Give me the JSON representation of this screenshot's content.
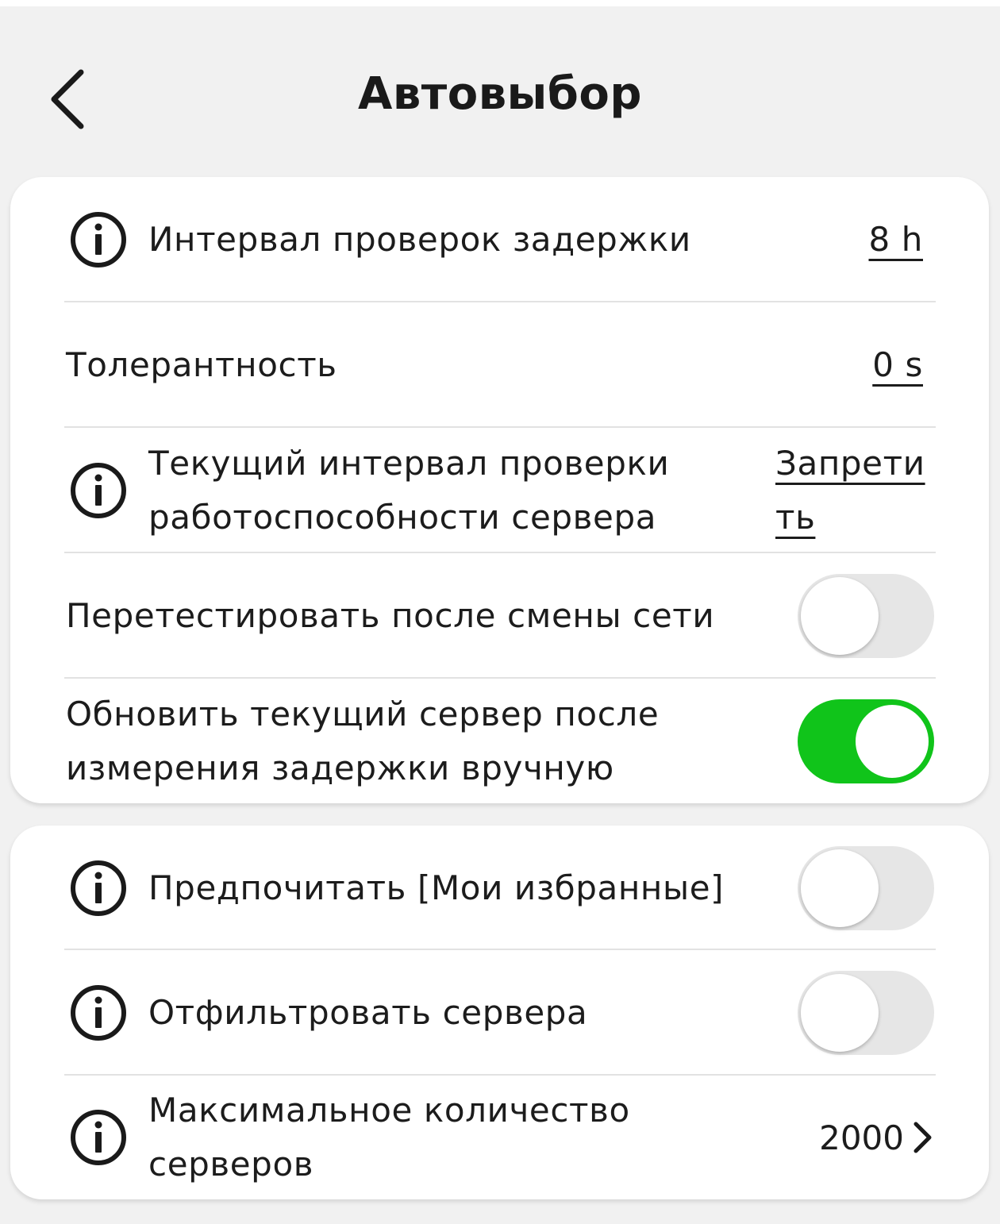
{
  "header": {
    "title": "Автовыбор",
    "back_icon": "chevron-left-icon"
  },
  "group1": {
    "latency_interval": {
      "label": "Интервал проверок задержки",
      "value": "8 h",
      "icon": "info-icon"
    },
    "tolerance": {
      "label": "Толерантность",
      "value": "0 s"
    },
    "health_check": {
      "label_line1": "Текущий интервал проверки",
      "label_line2": "работоспособности сервера",
      "value_line1": "Запрети",
      "value_line2": "ть",
      "icon": "info-icon"
    },
    "retest_network": {
      "label": "Перетестировать после смены сети",
      "enabled": false
    },
    "update_after_manual": {
      "label_line1": "Обновить текущий сервер после",
      "label_line2": "измерения задержки вручную",
      "enabled": true
    }
  },
  "group2": {
    "prefer_favorites": {
      "label": "Предпочитать [Мои избранные]",
      "enabled": false,
      "icon": "info-icon"
    },
    "filter_servers": {
      "label": "Отфильтровать сервера",
      "enabled": false,
      "icon": "info-icon"
    },
    "max_servers": {
      "label_line1": "Максимальное количество",
      "label_line2": "серверов",
      "value": "2000",
      "icon": "info-icon"
    }
  },
  "colors": {
    "toggle_on": "#10c41a",
    "toggle_off": "#e6e6e6",
    "background": "#f1f1f1",
    "card": "#ffffff"
  }
}
